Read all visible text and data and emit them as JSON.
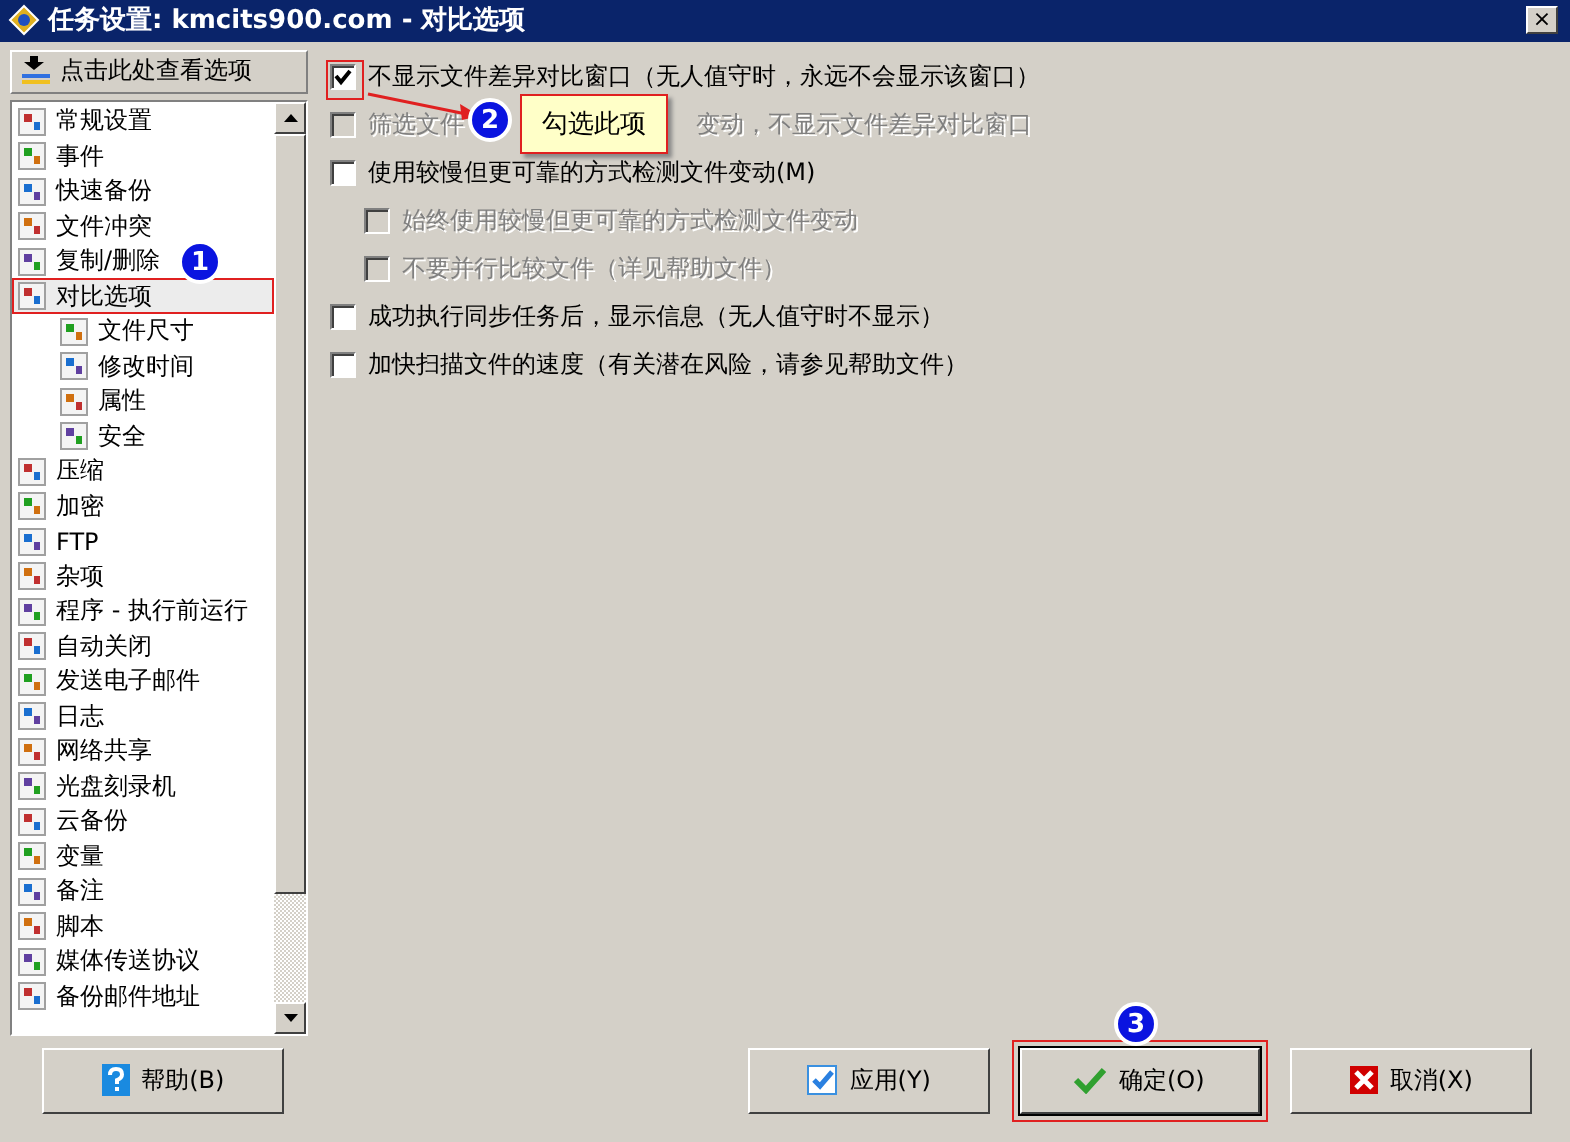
{
  "window": {
    "title": "任务设置: kmcits900.com - 对比选项",
    "close": "×"
  },
  "view_options_button": "点击此处查看选项",
  "sidebar": {
    "items": [
      {
        "label": "常规设置",
        "selected": false
      },
      {
        "label": "事件",
        "selected": false
      },
      {
        "label": "快速备份",
        "selected": false
      },
      {
        "label": "文件冲突",
        "selected": false
      },
      {
        "label": "复制/删除",
        "selected": false
      },
      {
        "label": "对比选项",
        "selected": true,
        "children": [
          {
            "label": "文件尺寸",
            "selected": false
          },
          {
            "label": "修改时间",
            "selected": false
          },
          {
            "label": "属性",
            "selected": false
          },
          {
            "label": "安全",
            "selected": false
          }
        ]
      },
      {
        "label": "压缩",
        "selected": false
      },
      {
        "label": "加密",
        "selected": false
      },
      {
        "label": "FTP",
        "selected": false
      },
      {
        "label": "杂项",
        "selected": false
      },
      {
        "label": "程序 - 执行前运行",
        "selected": false
      },
      {
        "label": "自动关闭",
        "selected": false
      },
      {
        "label": "发送电子邮件",
        "selected": false
      },
      {
        "label": "日志",
        "selected": false
      },
      {
        "label": "网络共享",
        "selected": false
      },
      {
        "label": "光盘刻录机",
        "selected": false
      },
      {
        "label": "云备份",
        "selected": false
      },
      {
        "label": "变量",
        "selected": false
      },
      {
        "label": "备注",
        "selected": false
      },
      {
        "label": "脚本",
        "selected": false
      },
      {
        "label": "媒体传送协议",
        "selected": false
      },
      {
        "label": "备份邮件地址",
        "selected": false
      }
    ]
  },
  "options": [
    {
      "label": "不显示文件差异对比窗口（无人值守时，永远不会显示该窗口）",
      "checked": true,
      "disabled": false
    },
    {
      "label": "筛选文件",
      "label_after_callout": "变动，不显示文件差异对比窗口",
      "checked": false,
      "disabled": true
    },
    {
      "label": "使用较慢但更可靠的方式检测文件变动(M)",
      "checked": false,
      "disabled": false,
      "children": [
        {
          "label": "始终使用较慢但更可靠的方式检测文件变动",
          "checked": false,
          "disabled": true
        },
        {
          "label": "不要并行比较文件（详见帮助文件）",
          "checked": false,
          "disabled": true
        }
      ]
    },
    {
      "label": "成功执行同步任务后，显示信息（无人值守时不显示）",
      "checked": false,
      "disabled": false
    },
    {
      "label": "加快扫描文件的速度（有关潜在风险，请参见帮助文件）",
      "checked": false,
      "disabled": false
    }
  ],
  "annotations": {
    "badge_1": "1",
    "badge_2": "2",
    "callout": "勾选此项",
    "badge_3": "3"
  },
  "buttons": [
    {
      "kind": "help",
      "label": "帮助(B)"
    },
    {
      "kind": "apply",
      "label": "应用(Y)"
    },
    {
      "kind": "ok",
      "label": "确定(O)",
      "highlighted": true
    },
    {
      "kind": "cancel",
      "label": "取消(X)"
    }
  ]
}
